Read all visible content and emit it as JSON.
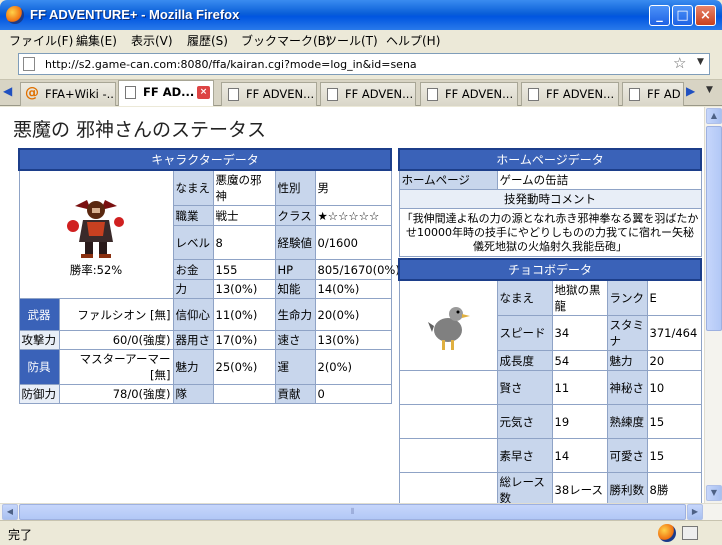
{
  "window": {
    "title": "FF ADVENTURE+ - Mozilla Firefox",
    "controls": {
      "minimize": "_",
      "maximize": "□",
      "close": "×"
    }
  },
  "menu": [
    "ファイル(F)",
    "編集(E)",
    "表示(V)",
    "履歴(S)",
    "ブックマーク(B)",
    "ツール(T)",
    "ヘルプ(H)"
  ],
  "url": "http://s2.game-can.com:8080/ffa/kairan.cgi?mode=log_in&id=sena",
  "tabs": [
    {
      "label": "FFA+Wiki -...",
      "icon": "at-icon"
    },
    {
      "label": "FF AD...",
      "icon": "page-icon",
      "active": true
    },
    {
      "label": "FF ADVEN...",
      "icon": "page-icon"
    },
    {
      "label": "FF ADVEN...",
      "icon": "page-icon"
    },
    {
      "label": "FF ADVEN...",
      "icon": "page-icon"
    },
    {
      "label": "FF ADVEN...",
      "icon": "page-icon"
    },
    {
      "label": "FF AD",
      "icon": "page-icon"
    }
  ],
  "page_title": "悪魔の 邪神さんのステータス",
  "character": {
    "header": "キャラクターデータ",
    "win_rate": "勝率:52%",
    "rows": [
      [
        "なまえ",
        "悪魔の邪神",
        "性別",
        "男"
      ],
      [
        "職業",
        "戦士",
        "クラス",
        "★☆☆☆☆☆"
      ],
      [
        "レベル",
        "8",
        "経験値",
        "0/1600"
      ],
      [
        "お金",
        "155",
        "HP",
        "805/1670(0%)"
      ],
      [
        "力",
        "13(0%)",
        "知能",
        "14(0%)"
      ]
    ],
    "weapon_label": "武器",
    "weapon_name": "ファルシオン [無]",
    "attack_label": "攻撃力",
    "attack_value": "60/0(強度)",
    "armor_label": "防具",
    "armor_name": "マスターアーマー [無]",
    "defense_label": "防御力",
    "defense_value": "78/0(強度)",
    "lower_rows": [
      [
        "信仰心",
        "11(0%)",
        "生命力",
        "20(0%)"
      ],
      [
        "器用さ",
        "17(0%)",
        "速さ",
        "13(0%)"
      ],
      [
        "魅力",
        "25(0%)",
        "運",
        "2(0%)"
      ],
      [
        "隊",
        "",
        "貢献",
        "0"
      ]
    ]
  },
  "homepage": {
    "header": "ホームページデータ",
    "label": "ホームページ",
    "value": "ゲームの缶詰",
    "comment_header": "技発動時コメント",
    "comment": "「我伸間達よ私の力の源となれ赤き邪神拳なる翼を羽ばたかせ10000年時の技手にやどりしものの力我てに宿れー矢秘儀死地獄の火焔射久我能岳砲」"
  },
  "chocobo": {
    "header": "チョコボデータ",
    "rows": [
      [
        "なまえ",
        "地獄の黒龍",
        "ランク",
        "E"
      ],
      [
        "スピード",
        "34",
        "スタミナ",
        "371/464"
      ],
      [
        "成長度",
        "54",
        "魅力",
        "20"
      ],
      [
        "賢さ",
        "11",
        "神秘さ",
        "10"
      ],
      [
        "元気さ",
        "19",
        "熟練度",
        "15"
      ],
      [
        "素早さ",
        "14",
        "可愛さ",
        "15"
      ],
      [
        "総レース数",
        "38レース",
        "勝利数",
        "8勝"
      ]
    ]
  },
  "status": "完了"
}
